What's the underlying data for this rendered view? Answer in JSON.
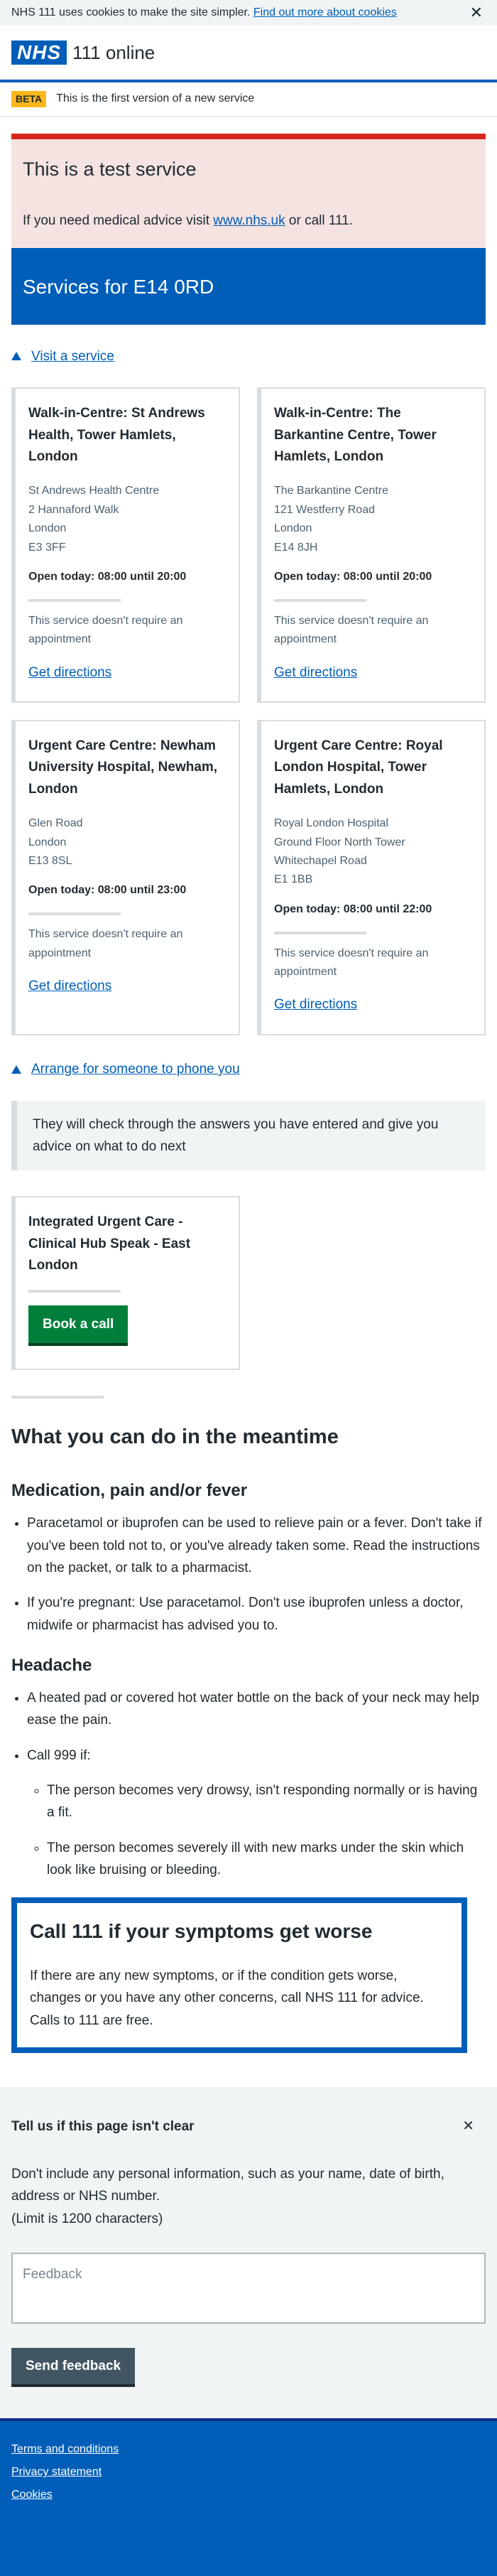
{
  "cookie": {
    "text": "NHS 111 uses cookies to make the site simpler. ",
    "link": "Find out more about cookies",
    "close": "✕"
  },
  "header": {
    "logo": "NHS",
    "service": "111 online"
  },
  "beta": {
    "tag": "BETA",
    "text": "This is the first version of a new service"
  },
  "test": {
    "title": "This is a test service",
    "text_before": "If you need medical advice visit ",
    "link": "www.nhs.uk",
    "text_after": " or call 111."
  },
  "services": {
    "title": "Services for E14 0RD",
    "visit_link": "Visit a service",
    "cards": [
      {
        "name": "Walk-in-Centre: St Andrews Health, Tower Hamlets, London",
        "address": [
          "St Andrews Health Centre",
          "2 Hannaford Walk",
          "London",
          "E3 3FF"
        ],
        "open": "Open today: 08:00 until 20:00",
        "note": "This service doesn't require an appointment",
        "directions": "Get directions"
      },
      {
        "name": "Walk-in-Centre: The Barkantine Centre, Tower Hamlets, London",
        "address": [
          "The Barkantine Centre",
          "121 Westferry Road",
          "London",
          "E14 8JH"
        ],
        "open": "Open today: 08:00 until 20:00",
        "note": "This service doesn't require an appointment",
        "directions": "Get directions"
      },
      {
        "name": "Urgent Care Centre: Newham University Hospital, Newham, London",
        "address": [
          "Glen Road",
          "London",
          "E13 8SL"
        ],
        "open": "Open today: 08:00 until 23:00",
        "note": "This service doesn't require an appointment",
        "directions": "Get directions"
      },
      {
        "name": "Urgent Care Centre: Royal London Hospital, Tower Hamlets, London",
        "address": [
          "Royal London Hospital",
          "Ground Floor North Tower",
          "Whitechapel Road",
          "E1 1BB"
        ],
        "open": "Open today: 08:00 until 22:00",
        "note": "This service doesn't require an appointment",
        "directions": "Get directions"
      }
    ]
  },
  "phone": {
    "link": "Arrange for someone to phone you",
    "inset": "They will check through the answers you have entered and give you advice on what to do next",
    "hub_name": "Integrated Urgent Care - Clinical Hub Speak - East London",
    "button": "Book a call"
  },
  "meantime": {
    "title": "What you can do in the meantime",
    "med_title": "Medication, pain and/or fever",
    "med_items": [
      "Paracetamol or ibuprofen can be used to relieve pain or a fever. Don't take if you've been told not to, or you've already taken some. Read the instructions on the packet, or talk to a pharmacist.",
      "If you're pregnant: Use paracetamol. Don't use ibuprofen unless a doctor, midwife or pharmacist has advised you to."
    ],
    "head_title": "Headache",
    "head_items": [
      "A heated pad or covered hot water bottle on the back of your neck may help ease the pain.",
      "Call 999 if:"
    ],
    "call999": [
      "The person becomes very drowsy, isn't responding normally or is having a fit.",
      "The person becomes severely ill with new marks under the skin which look like bruising or bleeding."
    ]
  },
  "callout": {
    "title": "Call 111 if your symptoms get worse",
    "text": "If there are any new symptoms, or if the condition gets worse, changes or you have any other concerns, call NHS 111 for advice. Calls to 111 are free."
  },
  "feedback": {
    "title": "Tell us if this page isn't clear",
    "close": "✕",
    "text": "Don't include any personal information, such as your name, date of birth, address or NHS number.",
    "limit": "(Limit is 1200 characters)",
    "placeholder": "Feedback",
    "button": "Send feedback"
  },
  "footer": {
    "links": [
      "Terms and conditions",
      "Privacy statement",
      "Cookies"
    ]
  }
}
